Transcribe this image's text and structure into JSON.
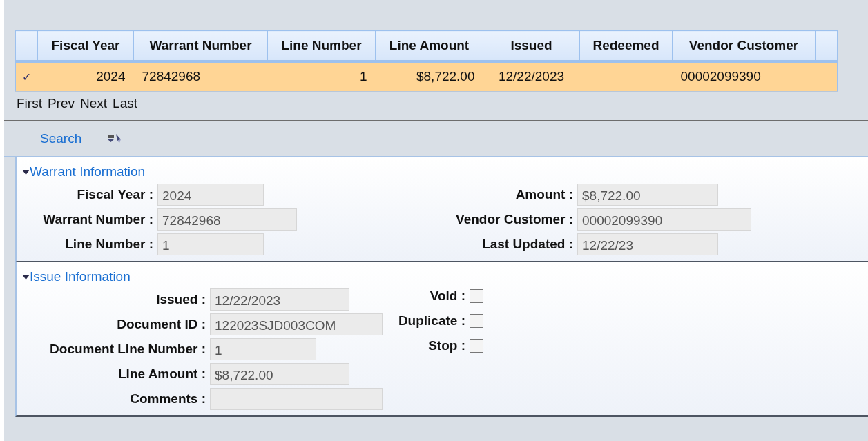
{
  "grid": {
    "columns": [
      {},
      {
        "label": "Fiscal Year"
      },
      {
        "label": "Warrant Number"
      },
      {
        "label": "Line Number"
      },
      {
        "label": "Line Amount"
      },
      {
        "label": "Issued"
      },
      {
        "label": "Redeemed"
      },
      {
        "label": "Vendor Customer"
      },
      {}
    ],
    "rows": [
      {
        "selected": true,
        "cells": [
          "✓",
          "2024",
          "72842968",
          "1",
          "$8,722.00",
          "12/22/2023",
          null,
          "00002099390"
        ]
      }
    ]
  },
  "pager": [
    "First",
    "Prev",
    "Next",
    "Last"
  ],
  "toolbar": {
    "search": "Search"
  },
  "sections": [
    {
      "title": "Warrant Information",
      "expanded": true,
      "kind": "fields2",
      "left": [
        {
          "label": "Fiscal Year :",
          "value": "2024"
        },
        {
          "label": "Warrant Number :",
          "value": "72842968"
        },
        {
          "label": "Line Number :",
          "value": "1"
        }
      ],
      "right": [
        {
          "label": "Amount :",
          "value": "$8,722.00"
        },
        {
          "label": "Vendor Customer :",
          "value": "00002099390"
        },
        {
          "label": "Last Updated :",
          "value": "12/22/23"
        }
      ]
    },
    {
      "title": "Issue Information",
      "expanded": true,
      "kind": "checks",
      "left": [
        {
          "label": "Issued :",
          "value": "12/22/2023"
        },
        {
          "label": "Document ID :",
          "value": "122023SJD003COM"
        },
        {
          "label": "Document Line Number :",
          "value": "1"
        },
        {
          "label": "Line Amount :",
          "value": "$8,722.00"
        },
        {
          "label": "Comments :"
        }
      ],
      "right": [
        {
          "label": "Void :",
          "checked": false
        },
        {
          "label": "Duplicate :",
          "checked": false
        },
        {
          "label": "Stop :",
          "checked": false
        }
      ]
    }
  ]
}
